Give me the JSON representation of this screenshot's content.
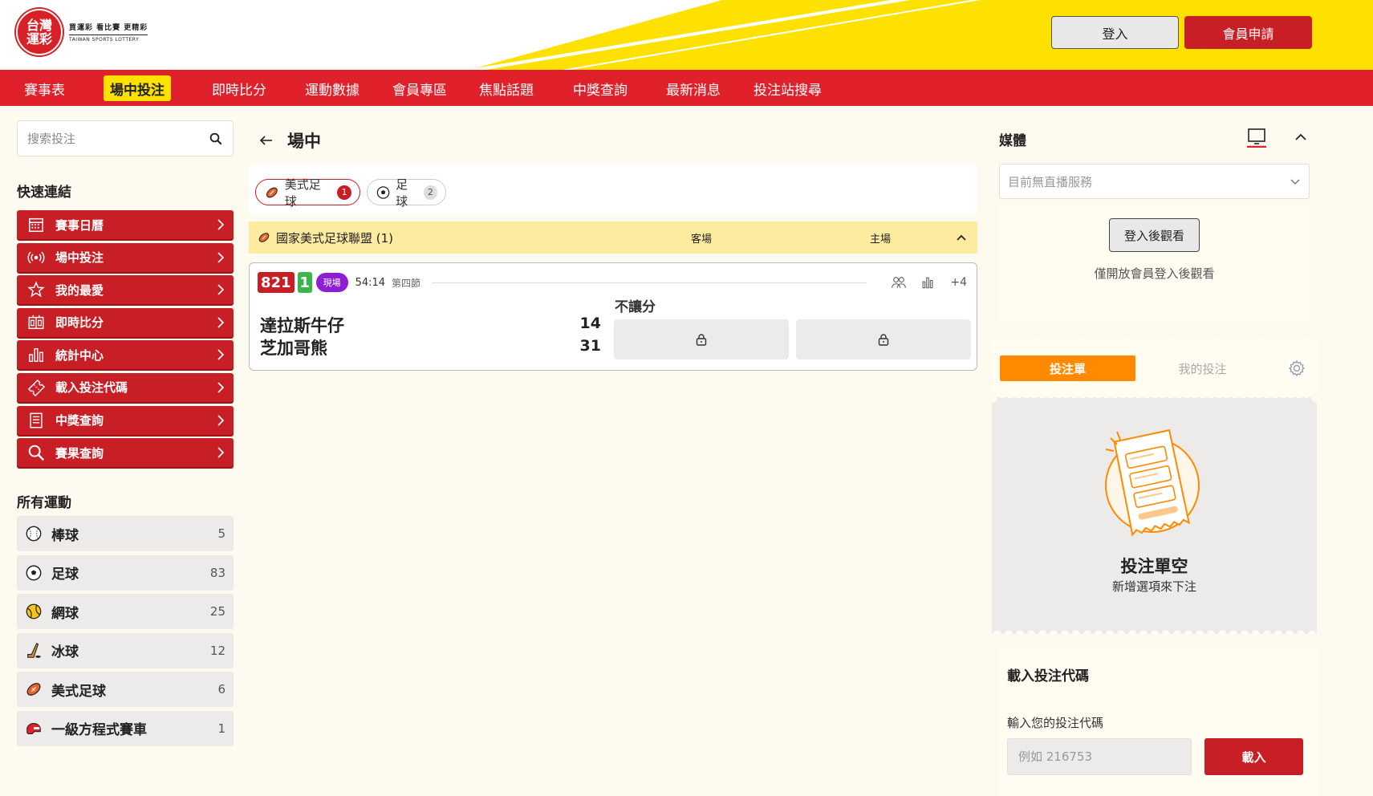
{
  "header": {
    "logo_line1": "台灣",
    "logo_line2": "運彩",
    "slogan": "買運彩 看比賽 更精彩",
    "english_name": "TAIWAN SPORTS LOTTERY",
    "login_label": "登入",
    "register_label": "會員申請"
  },
  "nav": {
    "items": [
      "賽事表",
      "場中投注",
      "即時比分",
      "運動數據",
      "會員專區",
      "焦點話題",
      "中獎查詢",
      "最新消息",
      "投注站搜尋"
    ],
    "active_index": 1
  },
  "sidebar": {
    "search_placeholder": "搜索投注",
    "quick_links_title": "快速連結",
    "quick_links": [
      {
        "label": "賽事日曆",
        "icon": "calendar-icon"
      },
      {
        "label": "場中投注",
        "icon": "live-broadcast-icon"
      },
      {
        "label": "我的最愛",
        "icon": "star-icon"
      },
      {
        "label": "即時比分",
        "icon": "scoreboard-icon"
      },
      {
        "label": "統計中心",
        "icon": "bar-chart-icon"
      },
      {
        "label": "載入投注代碼",
        "icon": "ticket-icon"
      },
      {
        "label": "中獎查詢",
        "icon": "receipt-icon"
      },
      {
        "label": "賽果查詢",
        "icon": "search-icon"
      }
    ],
    "all_sports_title": "所有運動",
    "sports": [
      {
        "label": "棒球",
        "count": "5",
        "icon": "baseball-icon"
      },
      {
        "label": "足球",
        "count": "83",
        "icon": "soccer-icon"
      },
      {
        "label": "網球",
        "count": "25",
        "icon": "tennis-icon"
      },
      {
        "label": "冰球",
        "count": "12",
        "icon": "hockey-icon"
      },
      {
        "label": "美式足球",
        "count": "6",
        "icon": "american-football-icon"
      },
      {
        "label": "一級方程式賽車",
        "count": "1",
        "icon": "helmet-icon"
      }
    ]
  },
  "main": {
    "title": "場中",
    "tabs": [
      {
        "label": "美式足球",
        "count": "1"
      },
      {
        "label": "足球",
        "count": "2"
      }
    ],
    "league": {
      "name": "國家美式足球聯盟 (1)",
      "away_label": "客場",
      "home_label": "主場"
    },
    "match": {
      "code": "821",
      "sub_code": "1",
      "live_label": "現場",
      "time": "54:14",
      "period": "第四節",
      "more": "+4",
      "market": "不讓分",
      "teams": [
        {
          "name": "達拉斯牛仔",
          "score": "14"
        },
        {
          "name": "芝加哥熊",
          "score": "31"
        }
      ]
    }
  },
  "media": {
    "title": "媒體",
    "select_value": "目前無直播服務",
    "watch_label": "登入後觀看",
    "watch_hint": "僅開放會員登入後觀看"
  },
  "betslip": {
    "tab_active": "投注單",
    "tab_other": "我的投注",
    "empty_title": "投注單空",
    "empty_sub": "新增選項來下注"
  },
  "load_code": {
    "title": "載入投注代碼",
    "label": "輸入您的投注代碼",
    "placeholder": "例如 216753",
    "button": "載入"
  },
  "colors": {
    "brand_red": "#e0202a",
    "accent_yellow": "#ffe100",
    "orange": "#ff8a00",
    "live_purple": "#8c1fd1",
    "green": "#3ab54a"
  }
}
